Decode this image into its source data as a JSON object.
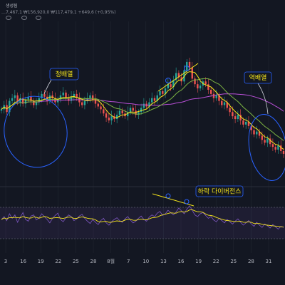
{
  "header": {
    "title": "생성됨",
    "ohlc": "…7,467,1  ₩156,920,0  ₩117,479,1  +649,6 (+0,95%)"
  },
  "annotations": [
    {
      "id": "ann-uptrend",
      "text": "정배열",
      "color": "#f5e51b"
    },
    {
      "id": "ann-downtrend",
      "text": "역배열",
      "color": "#f5e51b"
    },
    {
      "id": "ann-divergence",
      "text": "하락 다이버전스",
      "color": "#f5e51b"
    }
  ],
  "colors": {
    "background": "#131722",
    "candle_up": "#26a69a",
    "candle_down": "#ef5350",
    "ma_short": "#f5e51b",
    "ma_mid": "#7cb342",
    "ma_long": "#b84fd6",
    "oscillator": "#7e57c2",
    "oscillator_signal": "#f5e51b",
    "highlight_circle": "#2962ff",
    "trendline": "#f5e51b",
    "axis_text": "#b2b5be",
    "grid": "#2a2e39"
  },
  "chart_data": {
    "type": "candlestick",
    "x_tick_labels": [
      "3",
      "16",
      "19",
      "22",
      "25",
      "28",
      "8월",
      "7",
      "10",
      "13",
      "16",
      "19",
      "22",
      "25",
      "28",
      "31"
    ],
    "price_close_shape": [
      52,
      55,
      50,
      58,
      60,
      62,
      57,
      60,
      56,
      59,
      61,
      58,
      55,
      57,
      60,
      63,
      61,
      58,
      62,
      60,
      57,
      59,
      62,
      64,
      60,
      58,
      61,
      63,
      60,
      57,
      55,
      58,
      60,
      62,
      59,
      56,
      54,
      52,
      49,
      46,
      44,
      47,
      45,
      48,
      51,
      49,
      47,
      50,
      53,
      51,
      48,
      50,
      53,
      56,
      54,
      57,
      60,
      58,
      62,
      65,
      63,
      67,
      70,
      68,
      73,
      78,
      75,
      72,
      80,
      86,
      82,
      74,
      70,
      67,
      69,
      72,
      70,
      66,
      63,
      60,
      62,
      58,
      55,
      57,
      53,
      50,
      47,
      45,
      48,
      44,
      41,
      43,
      40,
      37,
      34,
      36,
      33,
      30,
      28,
      31,
      27,
      25,
      23,
      26,
      22,
      20
    ],
    "oscillator_shape": [
      50,
      55,
      48,
      60,
      52,
      58,
      45,
      54,
      62,
      50,
      47,
      56,
      58,
      49,
      53,
      60,
      55,
      50,
      44,
      52,
      57,
      61,
      50,
      46,
      53,
      58,
      55,
      48,
      51,
      56,
      59,
      52,
      47,
      43,
      50,
      45,
      41,
      48,
      52,
      44,
      40,
      46,
      50,
      53,
      48,
      45,
      51,
      55,
      49,
      44,
      47,
      52,
      56,
      50,
      47,
      54,
      58,
      55,
      61,
      64,
      57,
      60,
      66,
      62,
      58,
      63,
      70,
      65,
      60,
      68,
      74,
      66,
      58,
      55,
      60,
      62,
      57,
      52,
      55,
      49,
      46,
      52,
      48,
      44,
      50,
      46,
      42,
      47,
      51,
      45,
      40,
      44,
      48,
      42,
      38,
      45,
      40,
      36,
      42,
      39,
      35,
      41,
      37,
      33,
      38,
      36
    ],
    "oscillator_ylim": [
      0,
      100
    ],
    "oscillator_bands": [
      30,
      70
    ]
  }
}
